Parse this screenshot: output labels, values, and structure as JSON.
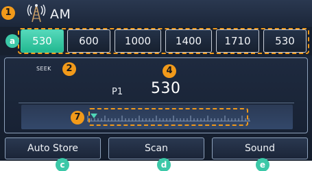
{
  "header": {
    "band": "AM",
    "icon": "antenna-icon"
  },
  "presets": [
    {
      "label": "530",
      "active": true
    },
    {
      "label": "600",
      "active": false
    },
    {
      "label": "1000",
      "active": false
    },
    {
      "label": "1400",
      "active": false
    },
    {
      "label": "1710",
      "active": false
    },
    {
      "label": "530",
      "active": false
    }
  ],
  "display": {
    "seek_label": "SEEK",
    "preset_number": "P1",
    "frequency": "530"
  },
  "buttons": {
    "auto_store": "Auto Store",
    "scan": "Scan",
    "sound": "Sound"
  },
  "callouts": {
    "c1": "1",
    "c2": "2",
    "c4": "4",
    "c7": "7",
    "ca": "a",
    "cc": "c",
    "cd": "d",
    "ce": "e"
  },
  "colors": {
    "accent": "#3ccaa8",
    "callout": "#f29a1a",
    "background": "#1a2538"
  }
}
